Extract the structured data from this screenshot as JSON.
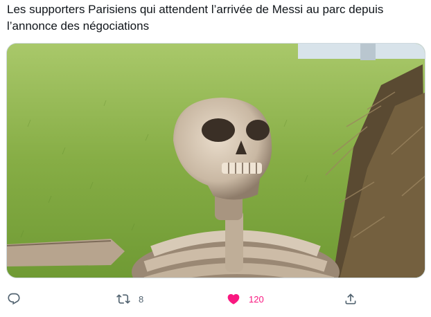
{
  "tweet": {
    "text": "Les supporters Parisiens qui attendent l’arrivée de Messi au parc depuis\nl’annonce des négociations"
  },
  "media": {
    "description_icon": "waiting-skeleton-meme"
  },
  "actions": {
    "reply": {
      "icon": "reply-icon"
    },
    "retweet": {
      "icon": "retweet-icon",
      "count": "8"
    },
    "like": {
      "icon": "heart-icon",
      "count": "120",
      "color": "#f91880"
    },
    "share": {
      "icon": "share-icon"
    }
  },
  "colors": {
    "text": "#0f1419",
    "muted": "#536471",
    "like": "#f91880",
    "border": "#cfd9de"
  }
}
